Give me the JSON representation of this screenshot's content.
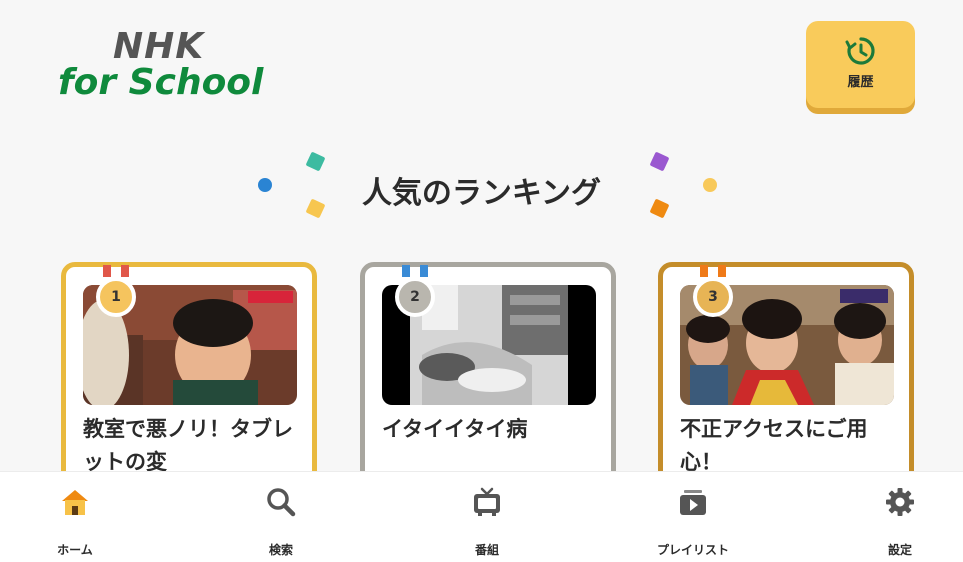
{
  "logo": {
    "line1": "NHK",
    "line2": "for School"
  },
  "history_button": {
    "label": "履歴",
    "icon": "history-icon"
  },
  "section": {
    "title": "人気のランキング"
  },
  "colors": {
    "gold": "#e9b93e",
    "silver": "#a8a69f",
    "bronze": "#c48d2a",
    "accent_yellow": "#f9cb5b",
    "brand_green": "#0f8a3c"
  },
  "ranking": [
    {
      "rank": "1",
      "title": "教室で悪ノリ！タブレットの変"
    },
    {
      "rank": "2",
      "title": "イタイイタイ病"
    },
    {
      "rank": "3",
      "title": "不正アクセスにご用心！"
    }
  ],
  "nav": [
    {
      "label": "ホーム",
      "icon": "home-icon",
      "active": true
    },
    {
      "label": "検索",
      "icon": "search-icon"
    },
    {
      "label": "番組",
      "icon": "tv-icon"
    },
    {
      "label": "プレイリスト",
      "icon": "playlist-icon"
    },
    {
      "label": "設定",
      "icon": "gear-icon"
    }
  ]
}
